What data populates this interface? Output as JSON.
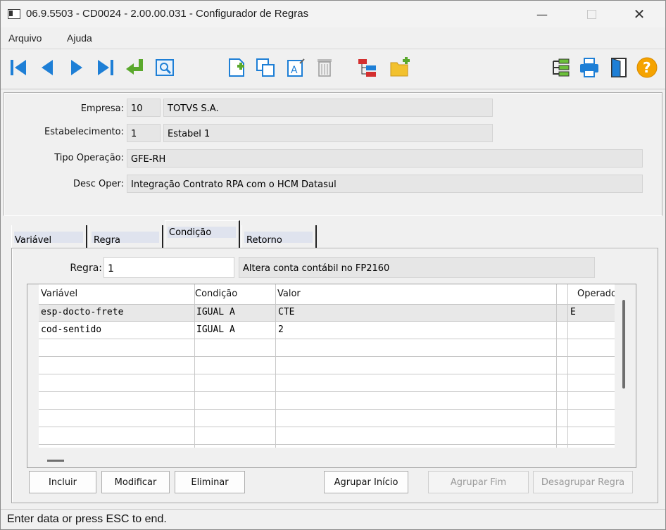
{
  "window": {
    "title": "06.9.5503 - CD0024 - 2.00.00.031 - Configurador de Regras"
  },
  "menu": [
    "Arquivo",
    "Ajuda"
  ],
  "toolbar": {
    "icons": [
      "first-icon",
      "previous-icon",
      "next-icon",
      "last-icon",
      "goto-icon",
      "search-icon",
      "new-icon",
      "copy-icon",
      "edit-icon",
      "delete-icon",
      "tree-icon",
      "new-folder-icon",
      "hierarchy-icon",
      "print-icon",
      "exit-icon",
      "help-icon"
    ],
    "help_glyph": "?"
  },
  "header": {
    "empresa_label": "Empresa:",
    "empresa_code": "10",
    "empresa_name": "TOTVS S.A.",
    "estab_label": "Estabelecimento:",
    "estab_code": "1",
    "estab_name": "Estabel 1",
    "tipo_label": "Tipo Operação:",
    "tipo_value": "GFE-RH",
    "desc_label": "Desc Oper:",
    "desc_value": "Integração Contrato RPA com o HCM Datasul"
  },
  "tabs": [
    "Variável",
    "Regra",
    "Condição",
    "Retorno"
  ],
  "active_tab": "Condição",
  "regra": {
    "label": "Regra:",
    "value": "1",
    "description": "Altera conta contábil no FP2160"
  },
  "grid": {
    "columns": [
      "Variável",
      "Condição",
      "Valor",
      "Operador"
    ],
    "rows": [
      [
        "esp-docto-frete",
        "IGUAL A",
        "CTE",
        "E"
      ],
      [
        "cod-sentido",
        "IGUAL A",
        "2",
        ""
      ]
    ]
  },
  "buttons": {
    "incluir": "Incluir",
    "modificar": "Modificar",
    "eliminar": "Eliminar",
    "agrupar_inicio": "Agrupar Início",
    "agrupar_fim": "Agrupar Fim",
    "desagrupar": "Desagrupar Regra"
  },
  "status": "Enter data or press ESC to end.",
  "colors": {
    "accent_blue": "#1e7fd6",
    "selected_row": "#e8e8e8"
  }
}
